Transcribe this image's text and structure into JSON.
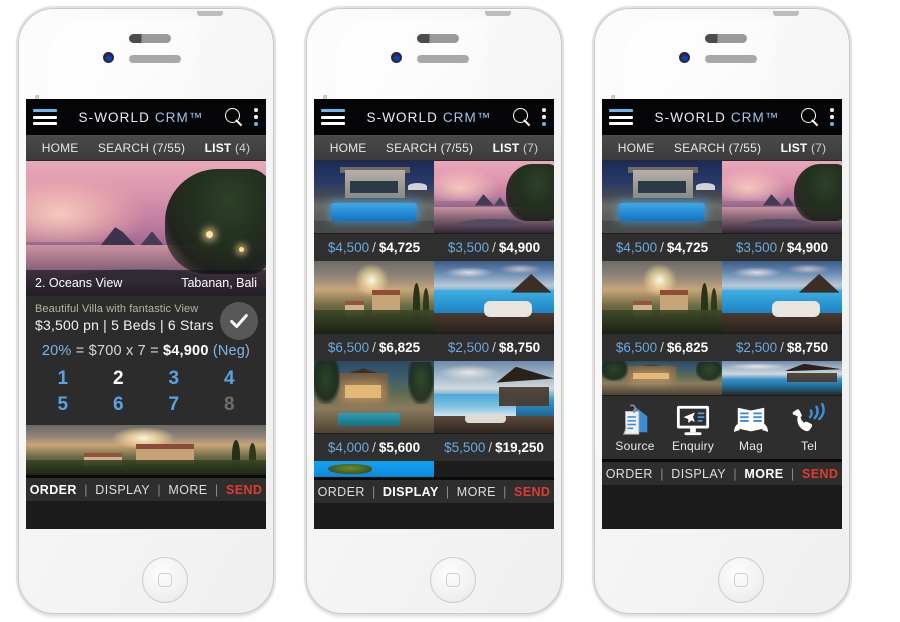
{
  "app": {
    "brand_main": "S-WORLD",
    "brand_suffix": "CRM™",
    "menu_icon": "hamburger-icon",
    "search_icon": "search-icon",
    "overflow_icon": "kebab-menu-icon",
    "accent_blue": "#5ba3e0",
    "accent_red": "#e03b32",
    "panel_bg": "#2c2c2c",
    "titlebar_bg": "#050507"
  },
  "nav": {
    "home": "HOME",
    "search": "SEARCH (7/55)",
    "list_label": "LIST",
    "list_count_p1": "(4)",
    "list_count_p2": "(7)",
    "list_count_p3": "(7)"
  },
  "bottom_nav": {
    "order": "ORDER",
    "display": "DISPLAY",
    "more": "MORE",
    "send": "SEND",
    "separator": "|",
    "active_phone1": "ORDER",
    "active_phone2": "DISPLAY",
    "active_phone3": "MORE"
  },
  "phone1": {
    "view": "detail",
    "hero": {
      "title": "2. Oceans View",
      "location": "Tabanan, Bali",
      "scene": "sunset-ocean-jetty"
    },
    "detail": {
      "tagline": "Beautiful Villa with fantastic View",
      "specs": "$3,500 pn | 5 Beds | 6 Stars",
      "check_icon": "checkmark-icon",
      "calc_percent": "20%",
      "calc_mid": "= $700 x 7 =",
      "calc_total": "$4,900",
      "calc_note": "(Neg)",
      "numbers": [
        {
          "label": "1",
          "state": "available"
        },
        {
          "label": "2",
          "state": "selected"
        },
        {
          "label": "3",
          "state": "available"
        },
        {
          "label": "4",
          "state": "available"
        },
        {
          "label": "5",
          "state": "available"
        },
        {
          "label": "6",
          "state": "available"
        },
        {
          "label": "7",
          "state": "available"
        },
        {
          "label": "8",
          "state": "disabled"
        }
      ]
    },
    "strip_scene": "tuscany-sunset-villa"
  },
  "phone2": {
    "view": "grid",
    "grid": [
      [
        {
          "price_low": "$4,500",
          "price_high": "$4,725",
          "scene": "modern-villa-pool"
        },
        {
          "price_low": "$3,500",
          "price_high": "$4,900",
          "scene": "sunset-ocean-jetty"
        }
      ],
      [
        {
          "price_low": "$6,500",
          "price_high": "$6,825",
          "scene": "tuscany-sunset-villa"
        },
        {
          "price_low": "$2,500",
          "price_high": "$8,750",
          "scene": "tropical-daybed-deck"
        }
      ],
      [
        {
          "price_low": "$4,000",
          "price_high": "$5,600",
          "scene": "bali-villa-night"
        },
        {
          "price_low": "$5,500",
          "price_high": "$19,250",
          "scene": "beach-bar-ocean"
        }
      ]
    ],
    "partial_row_scene": "blue-sky-island",
    "price_divider": "/"
  },
  "phone3": {
    "view": "grid-with-actions",
    "grid": [
      [
        {
          "price_low": "$4,500",
          "price_high": "$4,725",
          "scene": "modern-villa-pool"
        },
        {
          "price_low": "$3,500",
          "price_high": "$4,900",
          "scene": "sunset-ocean-jetty"
        }
      ],
      [
        {
          "price_low": "$6,500",
          "price_high": "$6,825",
          "scene": "tuscany-sunset-villa"
        },
        {
          "price_low": "$2,500",
          "price_high": "$8,750",
          "scene": "tropical-daybed-deck"
        }
      ]
    ],
    "price_divider": "/",
    "actions": [
      {
        "label": "Source",
        "icon": "document-clipboard-icon"
      },
      {
        "label": "Enquiry",
        "icon": "monitor-airplane-icon"
      },
      {
        "label": "Mag",
        "icon": "open-book-icon"
      },
      {
        "label": "Tel",
        "icon": "telephone-signal-icon"
      }
    ]
  }
}
